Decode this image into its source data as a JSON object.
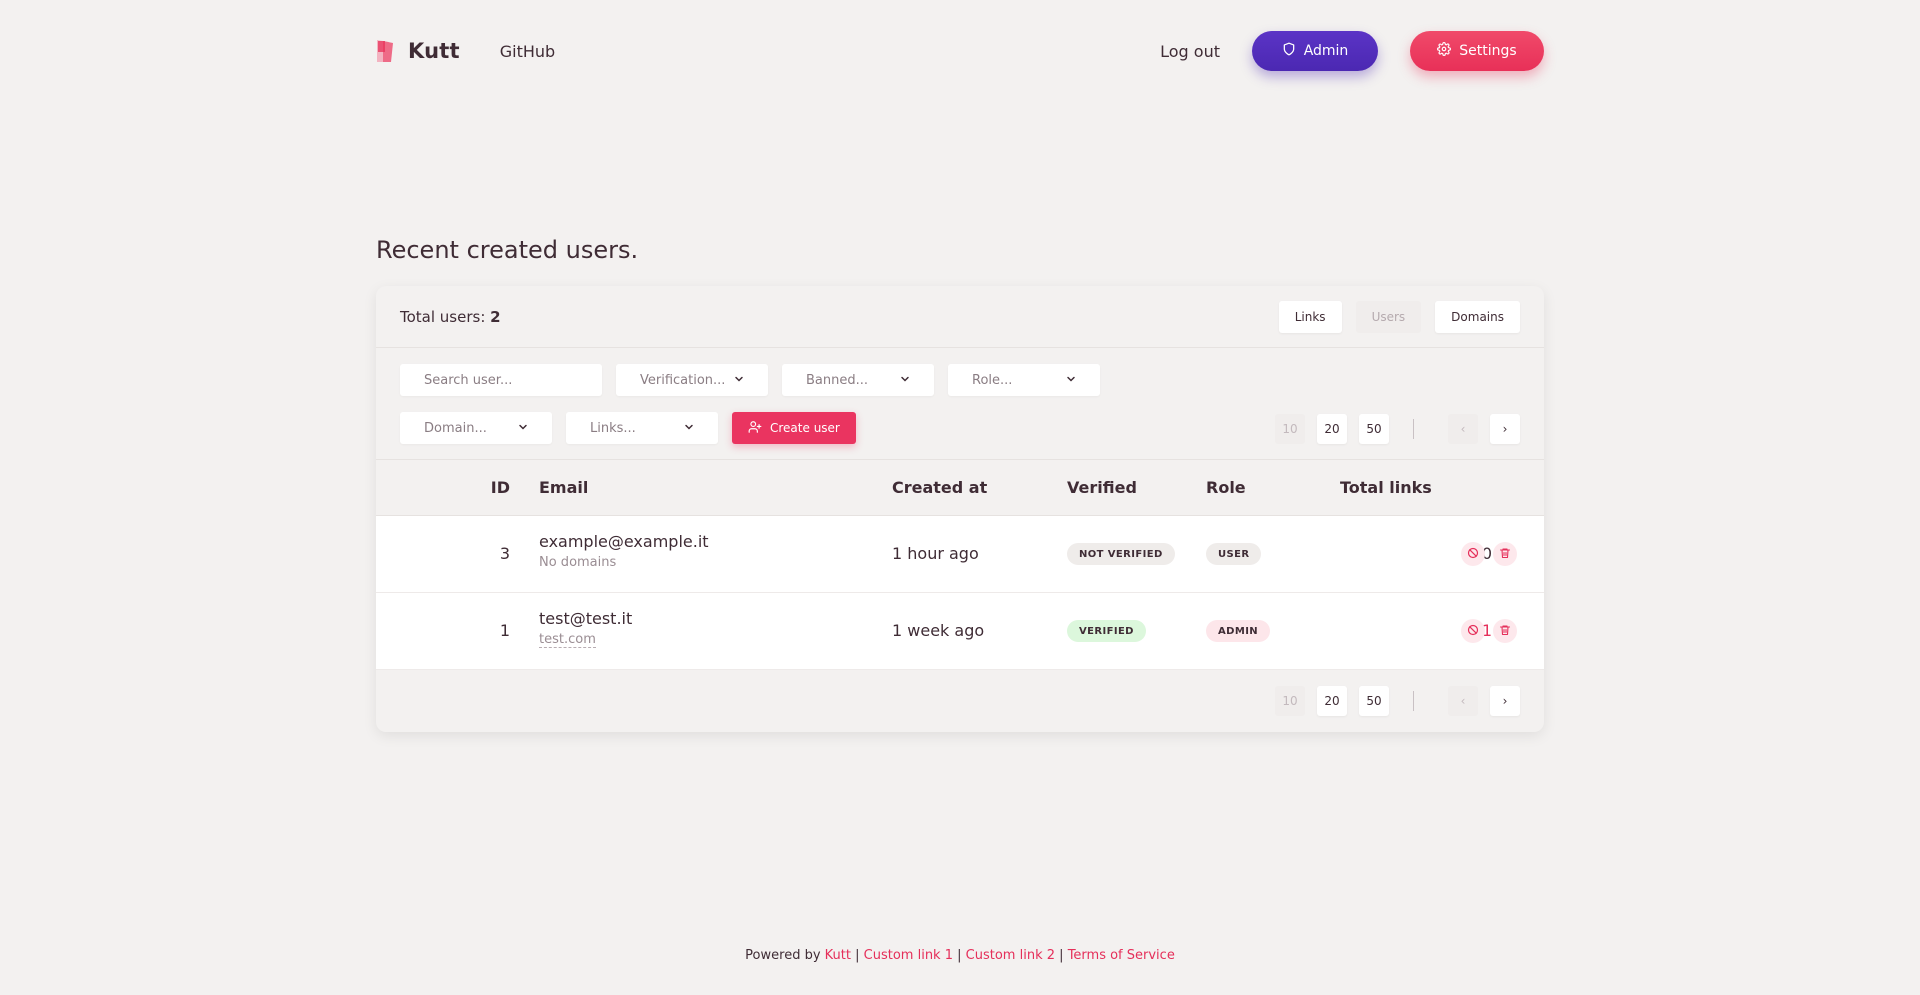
{
  "header": {
    "logo_text": "Kutt",
    "github_label": "GitHub",
    "logout_label": "Log out",
    "admin_label": "Admin",
    "settings_label": "Settings"
  },
  "colors": {
    "brand_pink": "#e83058",
    "admin_purple": "#4b28b2",
    "background": "#f3f1f0"
  },
  "page_title": "Recent created users.",
  "card": {
    "total_label": "Total users:",
    "total_value": "2",
    "tabs": [
      {
        "label": "Links",
        "active": false
      },
      {
        "label": "Users",
        "active": true
      },
      {
        "label": "Domains",
        "active": false
      }
    ],
    "filters": {
      "search_placeholder": "Search user...",
      "verification": "Verification...",
      "banned": "Banned...",
      "role": "Role...",
      "domain": "Domain...",
      "links": "Links...",
      "create_user_label": "Create user"
    },
    "pagination": {
      "sizes": [
        "10",
        "20",
        "50"
      ],
      "prev": "‹",
      "next": "›"
    }
  },
  "table": {
    "headers": {
      "id": "ID",
      "email": "Email",
      "created_at": "Created at",
      "verified": "Verified",
      "role": "Role",
      "total_links": "Total links"
    },
    "rows": [
      {
        "id": "3",
        "email": "example@example.it",
        "sub": "No domains",
        "created_at": "1 hour ago",
        "verified": "NOT VERIFIED",
        "role": "USER",
        "total_links": "0"
      },
      {
        "id": "1",
        "email": "test@test.it",
        "sub": "test.com",
        "created_at": "1 week ago",
        "verified": "VERIFIED",
        "role": "ADMIN",
        "total_links": "1"
      }
    ]
  },
  "footer": {
    "powered_by": "Powered by",
    "kutt": "Kutt",
    "sep": "|",
    "custom_link_1": "Custom link 1",
    "custom_link_2": "Custom link 2",
    "terms": "Terms of Service"
  }
}
